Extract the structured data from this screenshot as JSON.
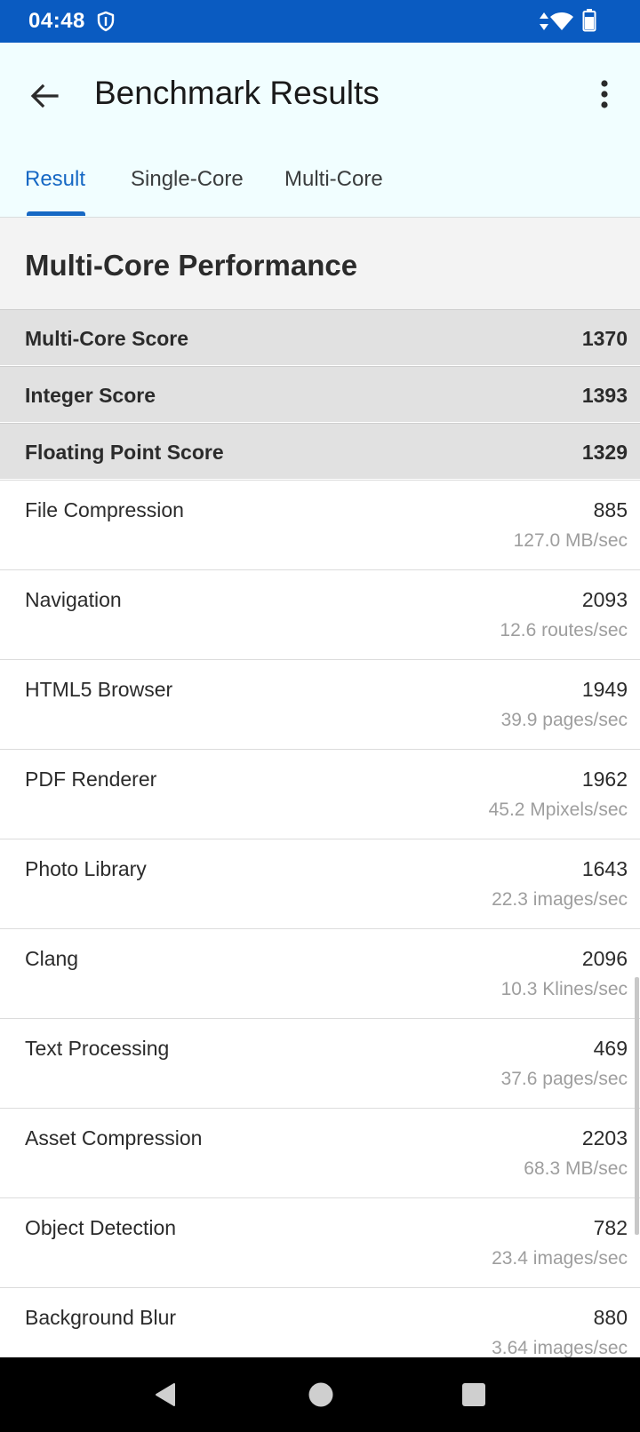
{
  "status_bar": {
    "time": "04:48",
    "icons": [
      "shield-icon",
      "data-arrows-icon",
      "wifi-icon",
      "battery-icon"
    ]
  },
  "app_bar": {
    "title": "Benchmark Results",
    "back_icon": "arrow-back-icon",
    "menu_icon": "more-vert-icon"
  },
  "tabs": [
    {
      "label": "Result",
      "active": true
    },
    {
      "label": "Single-Core",
      "active": false
    },
    {
      "label": "Multi-Core",
      "active": false
    }
  ],
  "section": {
    "title": "Multi-Core Performance"
  },
  "scores": [
    {
      "label": "Multi-Core Score",
      "value": "1370"
    },
    {
      "label": "Integer Score",
      "value": "1393"
    },
    {
      "label": "Floating Point Score",
      "value": "1329"
    }
  ],
  "benchmarks": [
    {
      "name": "File Compression",
      "score": "885",
      "rate": "127.0 MB/sec"
    },
    {
      "name": "Navigation",
      "score": "2093",
      "rate": "12.6 routes/sec"
    },
    {
      "name": "HTML5 Browser",
      "score": "1949",
      "rate": "39.9 pages/sec"
    },
    {
      "name": "PDF Renderer",
      "score": "1962",
      "rate": "45.2 Mpixels/sec"
    },
    {
      "name": "Photo Library",
      "score": "1643",
      "rate": "22.3 images/sec"
    },
    {
      "name": "Clang",
      "score": "2096",
      "rate": "10.3 Klines/sec"
    },
    {
      "name": "Text Processing",
      "score": "469",
      "rate": "37.6 pages/sec"
    },
    {
      "name": "Asset Compression",
      "score": "2203",
      "rate": "68.3 MB/sec"
    },
    {
      "name": "Object Detection",
      "score": "782",
      "rate": "23.4 images/sec"
    },
    {
      "name": "Background Blur",
      "score": "880",
      "rate": "3.64 images/sec"
    }
  ],
  "nav_bar": {
    "icons": [
      "nav-back-icon",
      "nav-home-icon",
      "nav-recents-icon"
    ]
  },
  "colors": {
    "status_bar": "#0a5bc1",
    "app_bar_bg": "#f1feff",
    "accent": "#1668c4",
    "score_row_bg": "#e1e1e1",
    "section_bg": "#f3f3f3",
    "rate_text": "#9e9e9e"
  }
}
